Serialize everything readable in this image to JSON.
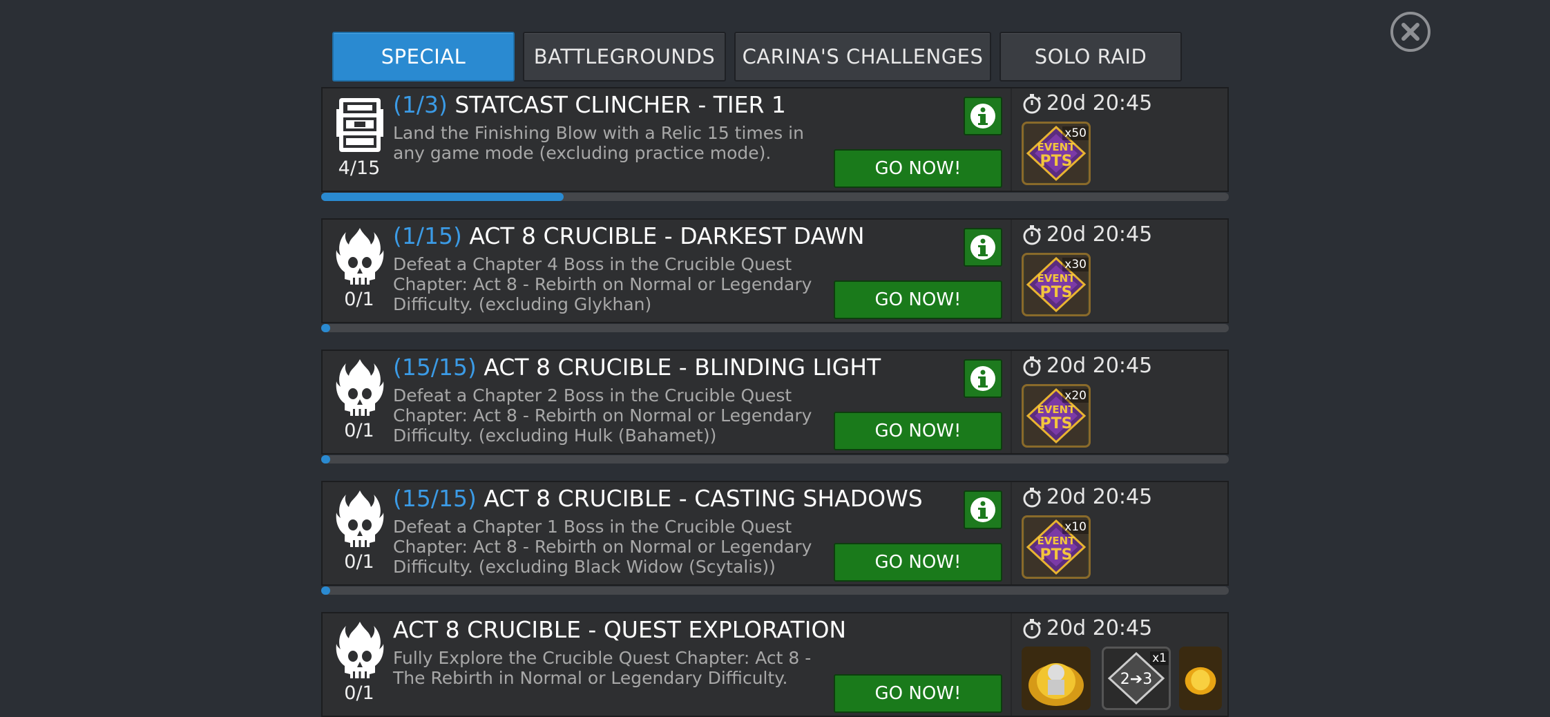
{
  "tabs": [
    {
      "label": "SPECIAL",
      "active": true
    },
    {
      "label": "BATTLEGROUNDS",
      "active": false
    },
    {
      "label": "CARINA'S CHALLENGES",
      "active": false
    },
    {
      "label": "SOLO RAID",
      "active": false
    }
  ],
  "quests": [
    {
      "icon": "relic-chest-icon",
      "count": "4/15",
      "progress_label": "(1/3)",
      "title": "STATCAST CLINCHER - TIER 1",
      "description": "Land the Finishing Blow with a Relic 15 times in any game mode (excluding practice mode).",
      "go_label": "GO NOW!",
      "timer": "20d 20:45",
      "rewards": [
        {
          "icon": "event-pts-icon",
          "mult": "x50"
        }
      ],
      "progress_fraction": 0.267
    },
    {
      "icon": "flaming-skull-icon",
      "count": "0/1",
      "progress_label": "(1/15)",
      "title": "ACT 8 CRUCIBLE - DARKEST DAWN",
      "description": "Defeat a Chapter 4 Boss in the Crucible Quest Chapter: Act 8 - Rebirth on Normal or Legendary Difficulty. (excluding Glykhan)",
      "go_label": "GO NOW!",
      "timer": "20d 20:45",
      "rewards": [
        {
          "icon": "event-pts-icon",
          "mult": "x30"
        }
      ],
      "progress_fraction": 0
    },
    {
      "icon": "flaming-skull-icon",
      "count": "0/1",
      "progress_label": "(15/15)",
      "title": "ACT 8 CRUCIBLE - BLINDING LIGHT",
      "description": "Defeat a Chapter 2 Boss in the Crucible Quest Chapter: Act 8 - Rebirth on Normal or Legendary Difficulty. (excluding Hulk (Bahamet))",
      "go_label": "GO NOW!",
      "timer": "20d 20:45",
      "rewards": [
        {
          "icon": "event-pts-icon",
          "mult": "x20"
        }
      ],
      "progress_fraction": 0
    },
    {
      "icon": "flaming-skull-icon",
      "count": "0/1",
      "progress_label": "(15/15)",
      "title": "ACT 8 CRUCIBLE - CASTING SHADOWS",
      "description": "Defeat a Chapter 1 Boss in the Crucible Quest Chapter: Act 8 - Rebirth on Normal or Legendary Difficulty. (excluding Black Widow (Scytalis))",
      "go_label": "GO NOW!",
      "timer": "20d 20:45",
      "rewards": [
        {
          "icon": "event-pts-icon",
          "mult": "x10"
        }
      ],
      "progress_fraction": 0
    },
    {
      "icon": "flaming-skull-icon",
      "count": "0/1",
      "progress_label": "",
      "title": "ACT 8 CRUCIBLE - QUEST EXPLORATION",
      "description": "Fully Explore the Crucible Quest Chapter: Act 8 - The Rebirth in Normal or Legendary Difficulty.",
      "go_label": "GO NOW!",
      "timer": "20d 20:45",
      "rewards": [
        {
          "icon": "champion-crystal-icon",
          "mult": ""
        },
        {
          "icon": "rank-up-2-3-icon",
          "label": "2➔3",
          "mult": "x1"
        },
        {
          "icon": "flaming-skull-reward-icon",
          "mult": ""
        }
      ]
    }
  ],
  "colors": {
    "accent": "#2a8ad1",
    "go_green": "#1a7a1b",
    "progress_blue": "#3b9be6"
  }
}
